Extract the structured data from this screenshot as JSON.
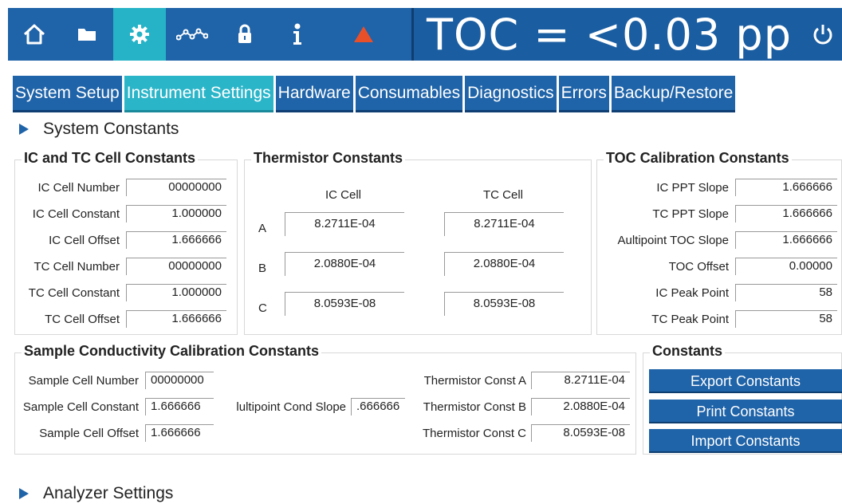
{
  "topbar": {
    "icons": [
      "home-icon",
      "folder-icon",
      "gear-icon",
      "trend-icon",
      "lock-icon",
      "info-icon",
      "alarm-icon"
    ],
    "toc_reading": "TOC = <0.03 pp",
    "power_icon": "power-icon",
    "colors": {
      "bar": "#1f63a8",
      "active": "#27b3c7",
      "alarm": "#e8502a"
    }
  },
  "tabs": [
    {
      "label": "System Setup"
    },
    {
      "label": "Instrument Settings"
    },
    {
      "label": "Hardware"
    },
    {
      "label": "Consumables"
    },
    {
      "label": "Diagnostics"
    },
    {
      "label": "Errors"
    },
    {
      "label": "Backup/Restore"
    }
  ],
  "system_constants": {
    "title": "System Constants"
  },
  "ic_tc": {
    "title": "IC and TC Cell Constants",
    "rows": [
      {
        "label": "IC Cell Number",
        "value": "00000000"
      },
      {
        "label": "IC Cell Constant",
        "value": "1.000000"
      },
      {
        "label": "IC Cell Offset",
        "value": "1.666666"
      },
      {
        "label": "TC Cell Number",
        "value": "00000000"
      },
      {
        "label": "TC Cell Constant",
        "value": "1.000000"
      },
      {
        "label": "TC Cell Offset",
        "value": "1.666666"
      }
    ]
  },
  "thermistor": {
    "title": "Thermistor Constants",
    "col_ic": "IC Cell",
    "col_tc": "TC Cell",
    "rows": [
      {
        "label": "A",
        "ic": "8.2711E-04",
        "tc": "8.2711E-04"
      },
      {
        "label": "B",
        "ic": "2.0880E-04",
        "tc": "2.0880E-04"
      },
      {
        "label": "C",
        "ic": "8.0593E-08",
        "tc": "8.0593E-08"
      }
    ]
  },
  "toc_cal": {
    "title": "TOC Calibration Constants",
    "rows": [
      {
        "label": "IC PPT Slope",
        "value": "1.666666"
      },
      {
        "label": "TC PPT Slope",
        "value": "1.666666"
      },
      {
        "label": "Aultipoint TOC Slope",
        "value": "1.666666"
      },
      {
        "label": "TOC Offset",
        "value": "0.00000"
      },
      {
        "label": "IC Peak Point",
        "value": "58"
      },
      {
        "label": "TC Peak Point",
        "value": "58"
      }
    ]
  },
  "sample": {
    "title": "Sample Conductivity Calibration Constants",
    "cell_number_label": "Sample Cell Number",
    "cell_number": "00000000",
    "cell_constant_label": "Sample Cell Constant",
    "cell_constant": "1.666666",
    "cell_offset_label": "Sample Cell Offset",
    "cell_offset": "1.666666",
    "multipoint_label": "lultipoint Cond Slope",
    "multipoint_value": ".666666",
    "therm_a_label": "Thermistor Const A",
    "therm_a": "8.2711E-04",
    "therm_b_label": "Thermistor Const B",
    "therm_b": "2.0880E-04",
    "therm_c_label": "Thermistor Const C",
    "therm_c": "8.0593E-08"
  },
  "constants_panel": {
    "title": "Constants",
    "export": "Export Constants",
    "print": "Print Constants",
    "import": "Import Constants"
  },
  "analyzer_settings": {
    "title": "Analyzer Settings"
  }
}
